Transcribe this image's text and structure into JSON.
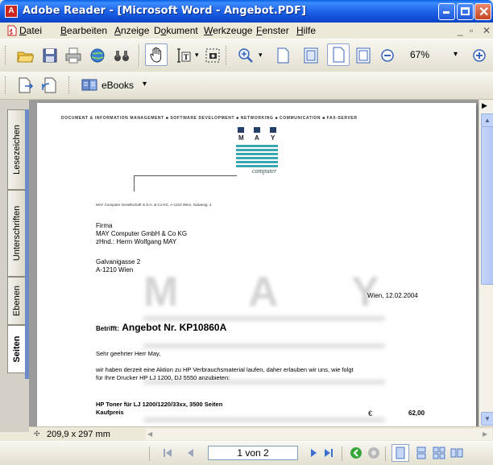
{
  "window": {
    "title": "Adobe Reader - [Microsoft Word - Angebot.PDF]"
  },
  "menu": {
    "items": [
      {
        "label": "Datei",
        "u": "D",
        "rest": "atei"
      },
      {
        "label": "Bearbeiten",
        "u": "B",
        "rest": "earbeiten"
      },
      {
        "label": "Anzeige",
        "u": "A",
        "rest": "nzeige"
      },
      {
        "label": "Dokument",
        "pre": "D",
        "u": "o",
        "rest": "kument"
      },
      {
        "label": "Werkzeuge",
        "u": "W",
        "rest": "erkzeuge"
      },
      {
        "label": "Fenster",
        "u": "F",
        "rest": "enster"
      },
      {
        "label": "Hilfe",
        "u": "H",
        "rest": "ilfe"
      }
    ]
  },
  "toolbar": {
    "zoom": "67%",
    "ebooks_label": "eBooks"
  },
  "nav_tabs": [
    "Lesezeichen",
    "Unterschriften",
    "Ebenen",
    "Seiten"
  ],
  "document": {
    "header": "DOCUMENT & INFORMATION MANAGEMENT ■ SOFTWARE DEVELOPMENT ■ NETWORKING ■ COMMUNICATION ■ FAX-SERVER",
    "logo_letters": [
      "M",
      "A",
      "Y"
    ],
    "logo_word": "computer",
    "sender_line": "MAY Computer Gesellschaft m.b.H. & Co KG,   A-1210 Wien, Galvanig. 2",
    "address": [
      "Firma",
      "MAY Computer GmbH & Co KG",
      "zHnd.: Herrn Wolfgang MAY"
    ],
    "street": [
      "Galvanigasse 2",
      "A-1210 Wien"
    ],
    "date": "Wien, 12.02.2004",
    "betreff_label": "Betrifft:",
    "betreff": "Angebot Nr. KP10860A",
    "salutation": "Sehr geehrter Herr May,",
    "body": [
      "wir haben derzeit eine Aktion zu HP Verbrauchsmaterial laufen, daher erlauben wir uns, wie folgt",
      "für Ihre Drucker HP LJ 1200, DJ 5550 anzubieten:"
    ],
    "product": [
      "HP Toner für LJ 1200/1220/33xx, 3500 Seiten",
      "Kaufpreis"
    ],
    "currency": "€",
    "price": "62,00"
  },
  "page_size": "209,9 x 297 mm",
  "status": {
    "page_indicator": "1 von 2"
  }
}
